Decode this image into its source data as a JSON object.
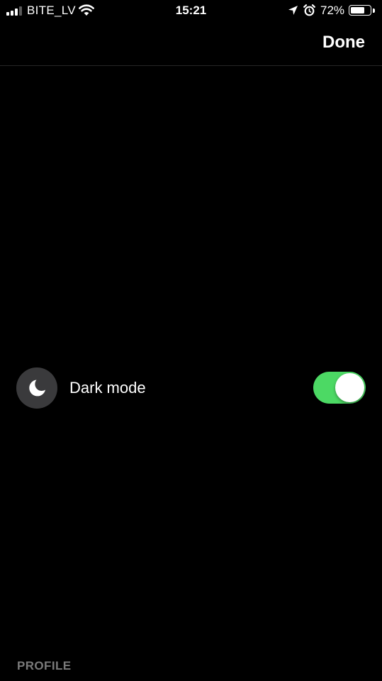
{
  "status_bar": {
    "carrier": "BITE_LV",
    "time": "15:21",
    "battery_percent": "72%",
    "battery_level": 0.72,
    "signal_bars_filled": 3,
    "signal_bars_total": 4
  },
  "nav": {
    "done_label": "Done"
  },
  "settings": {
    "dark_mode": {
      "label": "Dark mode",
      "icon": "moon-icon",
      "enabled": true
    }
  },
  "footer": {
    "section_label": "PROFILE"
  },
  "colors": {
    "background": "#000000",
    "toggle_on": "#4cd964",
    "icon_badge": "#3a3a3c",
    "footer_text": "#7a7a7a"
  }
}
